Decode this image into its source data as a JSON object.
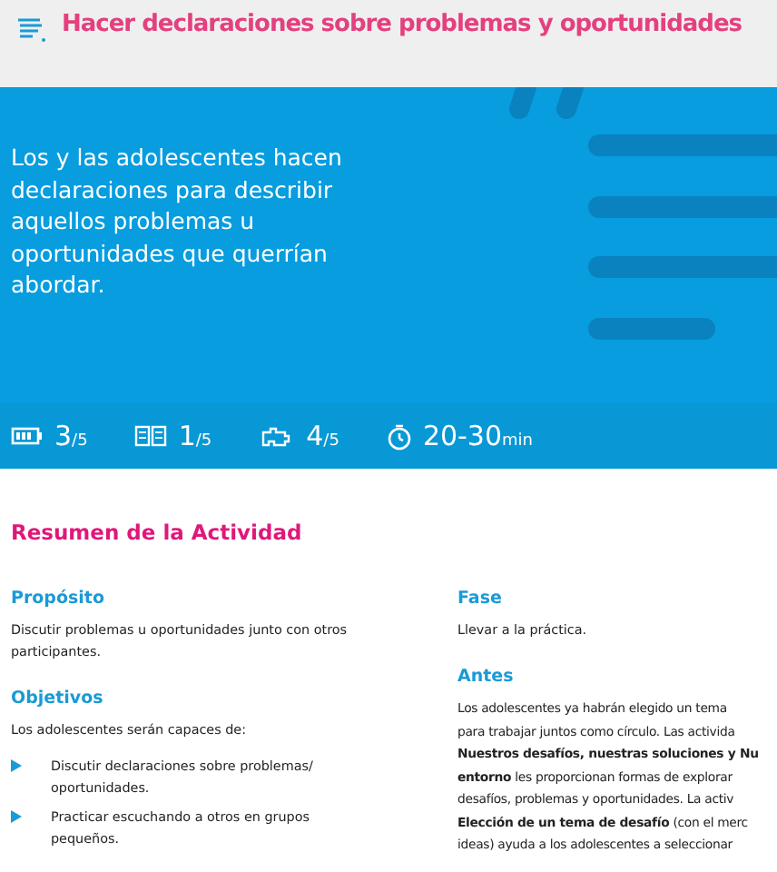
{
  "header": {
    "title": "Hacer declaraciones sobre problemas y oportunidades"
  },
  "hero": {
    "description": "Los y las adolescentes hacen declaraciones para describir aquellos problemas u oportunidades que querrían abordar.",
    "stats": [
      {
        "kind": "battery",
        "value": "3",
        "unit": "/5"
      },
      {
        "kind": "book",
        "value": "1",
        "unit": "/5"
      },
      {
        "kind": "puzzle",
        "value": "4",
        "unit": "/5"
      },
      {
        "kind": "timer",
        "value": "20-30",
        "unit": "min"
      }
    ]
  },
  "summary": {
    "title": "Resumen de la Actividad",
    "purpose": {
      "heading": "Propósito",
      "text": "Discutir problemas u oportunidades junto con otros participantes."
    },
    "objectives": {
      "heading": "Objetivos",
      "intro": "Los adolescentes serán capaces de:",
      "items": [
        "Discutir declaraciones sobre problemas/ oportunidades.",
        "Practicar escuchando a otros en grupos pequeños."
      ]
    },
    "phase": {
      "heading": "Fase",
      "text": "Llevar a la práctica."
    },
    "before": {
      "heading": "Antes",
      "lines": [
        "Los adolescentes ya habrán elegido un tema",
        "para trabajar juntos como círculo. Las activida",
        "**Nuestros desafíos, nuestras soluciones y Nu**",
        "**entorno** les proporcionan formas de explorar",
        "desafíos, problemas y oportunidades. La activ",
        "**Elección de un tema de desafío** (con el merc",
        "ideas) ayuda a los adolescentes a seleccionar"
      ]
    }
  }
}
